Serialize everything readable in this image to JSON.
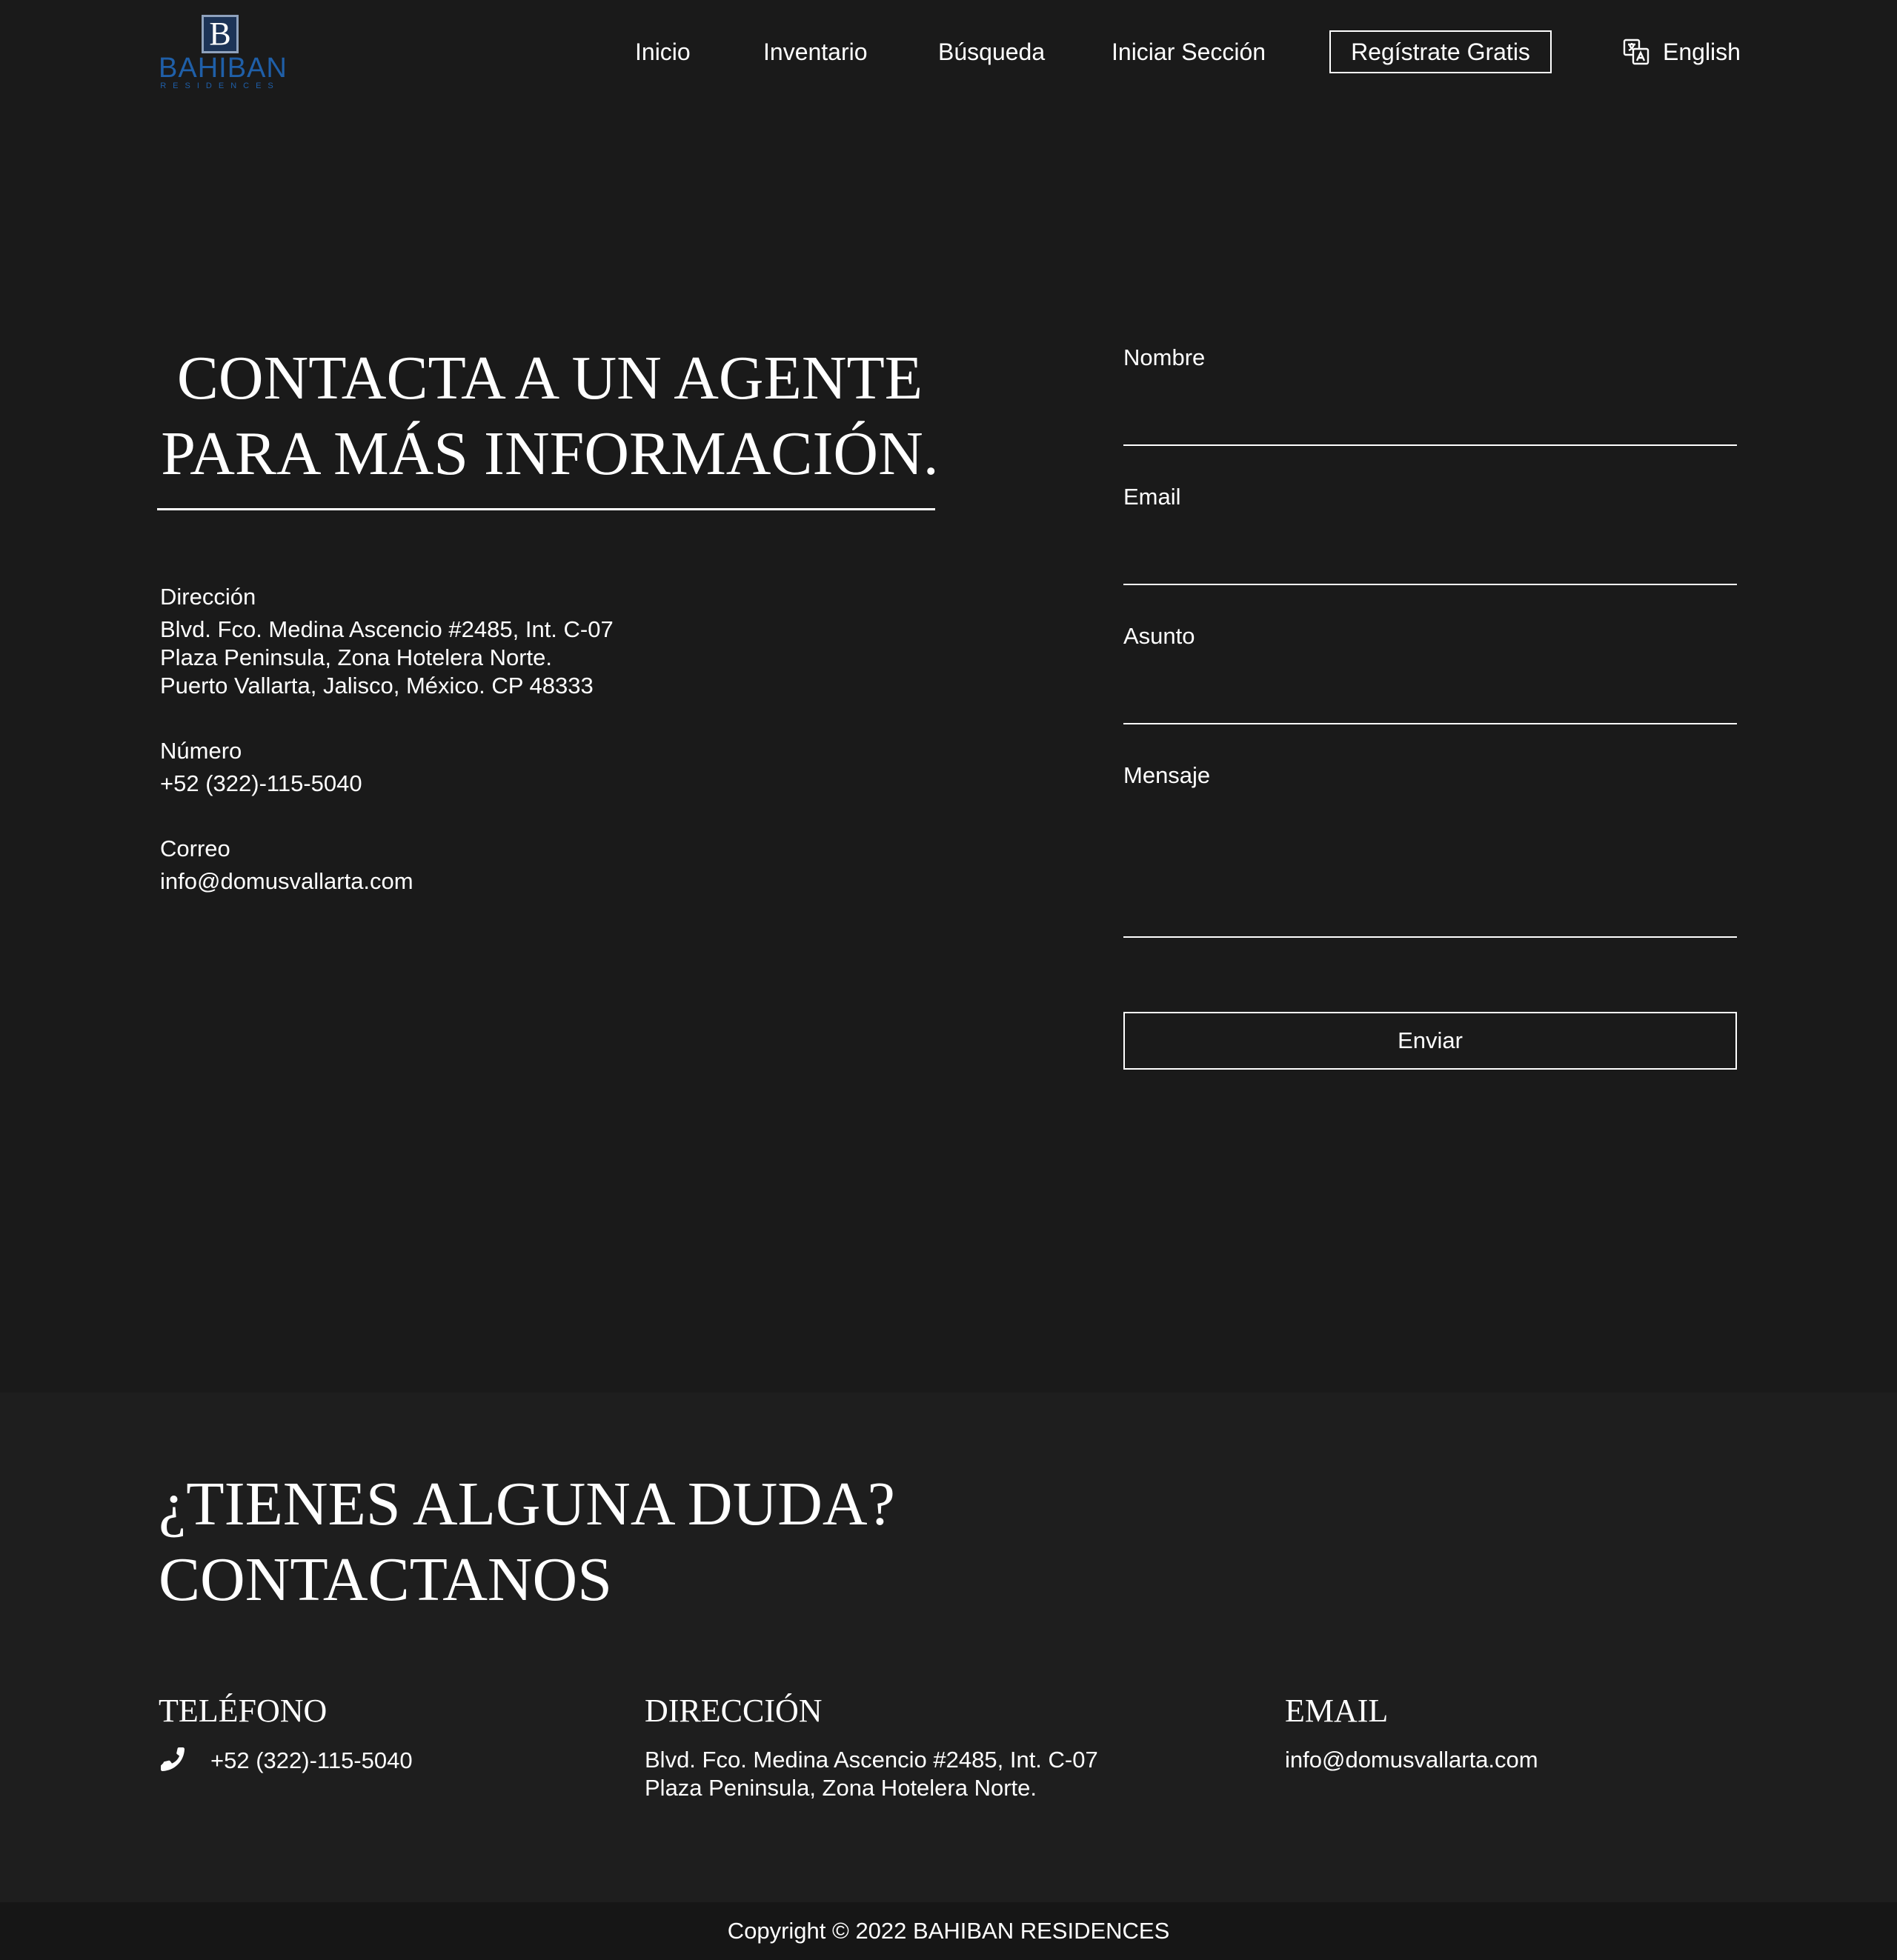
{
  "brand": {
    "mark": "B",
    "name": "BAHIBAN",
    "tagline": "RESIDENCES",
    "color": "#1f5fa8"
  },
  "nav": {
    "items": [
      "Inicio",
      "Inventario",
      "Búsqueda",
      "Iniciar Sección"
    ],
    "cta": "Regístrate Gratis",
    "language": "English",
    "language_icon": "translate-icon"
  },
  "contact": {
    "title_line1": "CONTACTA A UN AGENTE",
    "title_line2": "PARA MÁS INFORMACIÓN.",
    "address_label": "Dirección",
    "address_lines": [
      "Blvd. Fco. Medina Ascencio #2485, Int. C-07",
      "Plaza Peninsula, Zona Hotelera Norte.",
      "Puerto Vallarta, Jalisco, México. CP 48333"
    ],
    "phone_label": "Número",
    "phone": "+52 (322)-115-5040",
    "email_label": "Correo",
    "email": "info@domusvallarta.com"
  },
  "form": {
    "name_label": "Nombre",
    "email_label": "Email",
    "subject_label": "Asunto",
    "message_label": "Mensaje",
    "submit_label": "Enviar"
  },
  "footer": {
    "title_line1": "¿TIENES ALGUNA DUDA?",
    "title_line2": "CONTACTANOS",
    "phone_heading": "TELÉFONO",
    "phone": "+52 (322)-115-5040",
    "address_heading": "DIRECCIÓN",
    "address_lines": [
      "Blvd. Fco. Medina Ascencio #2485, Int. C-07",
      "Plaza Peninsula, Zona Hotelera Norte."
    ],
    "email_heading": "EMAIL",
    "email": "info@domusvallarta.com",
    "copyright": "Copyright © 2022 BAHIBAN RESIDENCES"
  },
  "colors": {
    "background": "#1a1a1a",
    "footer_background": "#1e1e1e",
    "copyright_background": "#161616",
    "text": "#ffffff"
  }
}
